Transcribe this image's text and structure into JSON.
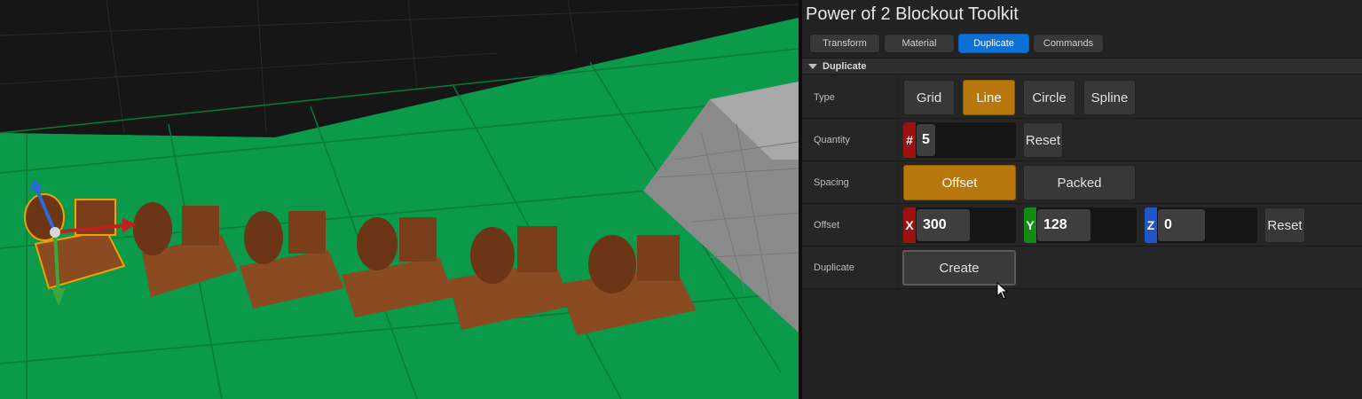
{
  "panel": {
    "title": "Power of 2 Blockout Toolkit",
    "tabs": [
      {
        "label": "Transform",
        "active": false
      },
      {
        "label": "Material",
        "active": false
      },
      {
        "label": "Duplicate",
        "active": true
      },
      {
        "label": "Commands",
        "active": false
      }
    ],
    "section": {
      "label": "Duplicate",
      "expanded": true
    }
  },
  "rows": {
    "type": {
      "label": "Type",
      "options": [
        "Grid",
        "Line",
        "Circle",
        "Spline"
      ],
      "selected": "Line"
    },
    "quantity": {
      "label": "Quantity",
      "prefix": "#",
      "value": "5",
      "reset_label": "Reset"
    },
    "spacing": {
      "label": "Spacing",
      "options": [
        "Offset",
        "Packed"
      ],
      "selected": "Offset"
    },
    "offset": {
      "label": "Offset",
      "x_prefix": "X",
      "x": "300",
      "y_prefix": "Y",
      "y": "128",
      "z_prefix": "Z",
      "z": "0",
      "reset_label": "Reset"
    },
    "duplicate": {
      "label": "Duplicate",
      "button_label": "Create"
    }
  },
  "colors": {
    "accent_active_tab": "#0d70d8",
    "accent_selected_option": "#b8770c",
    "axis_x": "#9e1111",
    "axis_y": "#138a13",
    "axis_z": "#1f56c9",
    "viewport_floor": "#0a9a4a"
  },
  "icons": {
    "section_toggle": "triangle-down-icon",
    "cursor": "mouse-pointer-icon",
    "gizmo": "transform-gizmo-icon"
  }
}
